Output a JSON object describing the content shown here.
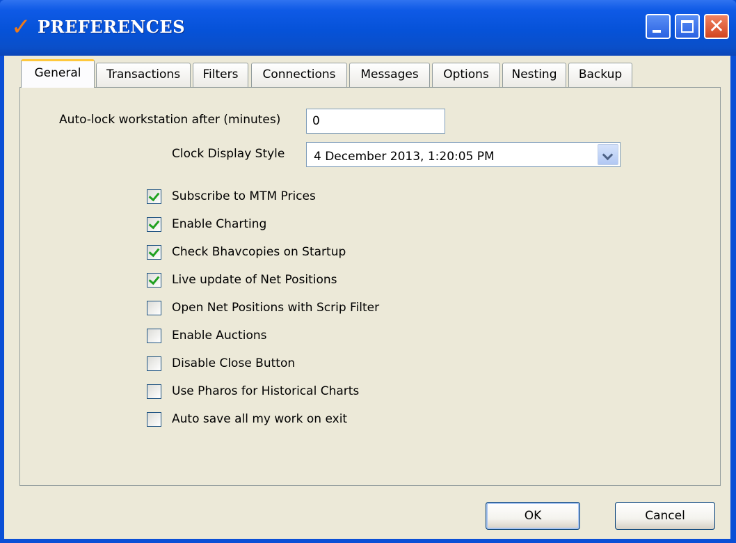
{
  "window": {
    "title": "PREFERENCES",
    "icons": {
      "app": "checkmark-icon",
      "minimize": "minimize-icon",
      "maximize": "maximize-icon",
      "close": "close-icon"
    },
    "colors": {
      "titlebar": "#0652d8",
      "client": "#ece9d8",
      "tab_accent": "#ffc83c",
      "check": "#21a121"
    }
  },
  "tabs": [
    {
      "label": "General",
      "active": true
    },
    {
      "label": "Transactions",
      "active": false
    },
    {
      "label": "Filters",
      "active": false
    },
    {
      "label": "Connections",
      "active": false
    },
    {
      "label": "Messages",
      "active": false
    },
    {
      "label": "Options",
      "active": false
    },
    {
      "label": "Nesting",
      "active": false
    },
    {
      "label": "Backup",
      "active": false
    }
  ],
  "general": {
    "autolock_label": "Auto-lock workstation after (minutes)",
    "autolock_value": "0",
    "clock_label": "Clock Display Style",
    "clock_value": "4 December 2013, 1:20:05 PM",
    "options": [
      {
        "label": "Subscribe to MTM Prices",
        "checked": true
      },
      {
        "label": "Enable Charting",
        "checked": true
      },
      {
        "label": "Check Bhavcopies on Startup",
        "checked": true
      },
      {
        "label": "Live update of Net Positions",
        "checked": true
      },
      {
        "label": "Open Net Positions with Scrip Filter",
        "checked": false
      },
      {
        "label": "Enable Auctions",
        "checked": false
      },
      {
        "label": "Disable Close Button",
        "checked": false
      },
      {
        "label": "Use Pharos for Historical Charts",
        "checked": false
      },
      {
        "label": "Auto save all my work on exit",
        "checked": false
      }
    ]
  },
  "buttons": {
    "ok": "OK",
    "cancel": "Cancel"
  }
}
